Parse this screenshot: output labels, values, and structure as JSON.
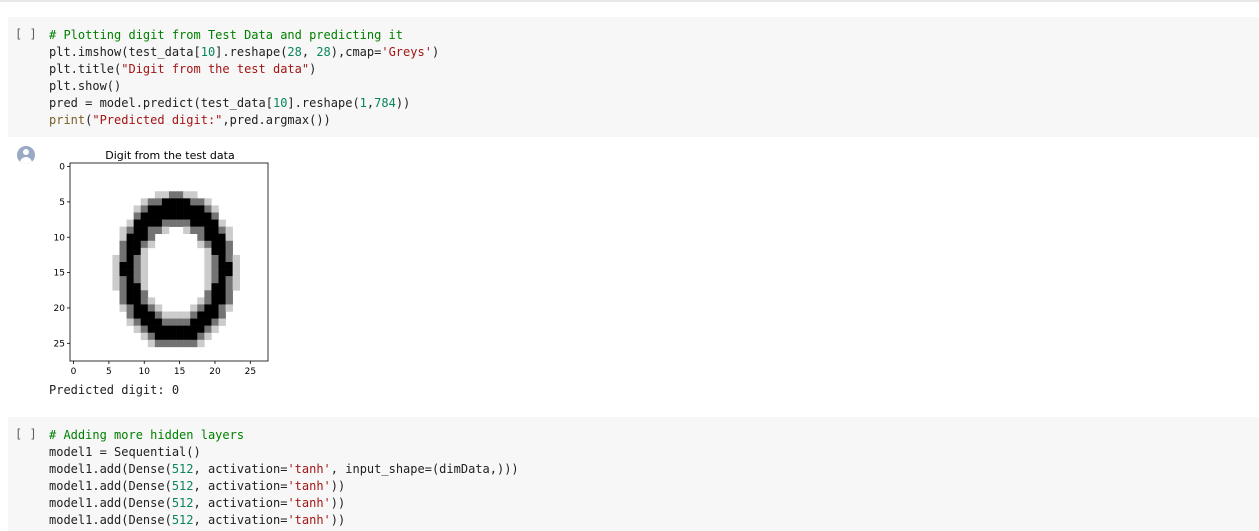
{
  "cell1": {
    "run_label": "[ ]",
    "code": [
      [
        {
          "t": "# Plotting digit from Test Data and predicting it",
          "c": "cm"
        }
      ],
      [
        {
          "t": "plt.imshow(test_data[",
          "c": ""
        },
        {
          "t": "10",
          "c": "num"
        },
        {
          "t": "].reshape(",
          "c": ""
        },
        {
          "t": "28",
          "c": "num"
        },
        {
          "t": ", ",
          "c": ""
        },
        {
          "t": "28",
          "c": "num"
        },
        {
          "t": "),cmap=",
          "c": ""
        },
        {
          "t": "'Greys'",
          "c": "str"
        },
        {
          "t": ")",
          "c": ""
        }
      ],
      [
        {
          "t": "plt.title(",
          "c": ""
        },
        {
          "t": "\"Digit from the test data\"",
          "c": "str"
        },
        {
          "t": ")",
          "c": ""
        }
      ],
      [
        {
          "t": "plt.show()",
          "c": ""
        }
      ],
      [
        {
          "t": "pred = model.predict(test_data[",
          "c": ""
        },
        {
          "t": "10",
          "c": "num"
        },
        {
          "t": "].reshape(",
          "c": ""
        },
        {
          "t": "1",
          "c": "num"
        },
        {
          "t": ",",
          "c": ""
        },
        {
          "t": "784",
          "c": "num"
        },
        {
          "t": "))",
          "c": ""
        }
      ],
      [
        {
          "t": "print",
          "c": "kw"
        },
        {
          "t": "(",
          "c": ""
        },
        {
          "t": "\"Predicted digit:\"",
          "c": "str"
        },
        {
          "t": ",pred.argmax())",
          "c": ""
        }
      ]
    ]
  },
  "output": {
    "figure_title": "Digit from the test data",
    "y_ticks": [
      "0",
      "5",
      "10",
      "15",
      "20",
      "25"
    ],
    "x_ticks": [
      "0",
      "5",
      "10",
      "15",
      "20",
      "25"
    ],
    "stdout": "Predicted digit: 0"
  },
  "cell2": {
    "run_label": "[ ]",
    "code": [
      [
        {
          "t": "# Adding more hidden layers",
          "c": "cm"
        }
      ],
      [
        {
          "t": "model1 = Sequential()",
          "c": ""
        }
      ],
      [
        {
          "t": "model1.add(Dense(",
          "c": ""
        },
        {
          "t": "512",
          "c": "num"
        },
        {
          "t": ", activation=",
          "c": ""
        },
        {
          "t": "'tanh'",
          "c": "str"
        },
        {
          "t": ", input_shape=(dimData,)))",
          "c": ""
        }
      ],
      [
        {
          "t": "model1.add(Dense(",
          "c": ""
        },
        {
          "t": "512",
          "c": "num"
        },
        {
          "t": ", activation=",
          "c": ""
        },
        {
          "t": "'tanh'",
          "c": "str"
        },
        {
          "t": "))",
          "c": ""
        }
      ],
      [
        {
          "t": "model1.add(Dense(",
          "c": ""
        },
        {
          "t": "512",
          "c": "num"
        },
        {
          "t": ", activation=",
          "c": ""
        },
        {
          "t": "'tanh'",
          "c": "str"
        },
        {
          "t": "))",
          "c": ""
        }
      ],
      [
        {
          "t": "model1.add(Dense(",
          "c": ""
        },
        {
          "t": "512",
          "c": "num"
        },
        {
          "t": ", activation=",
          "c": ""
        },
        {
          "t": "'tanh'",
          "c": "str"
        },
        {
          "t": "))",
          "c": ""
        }
      ]
    ]
  }
}
